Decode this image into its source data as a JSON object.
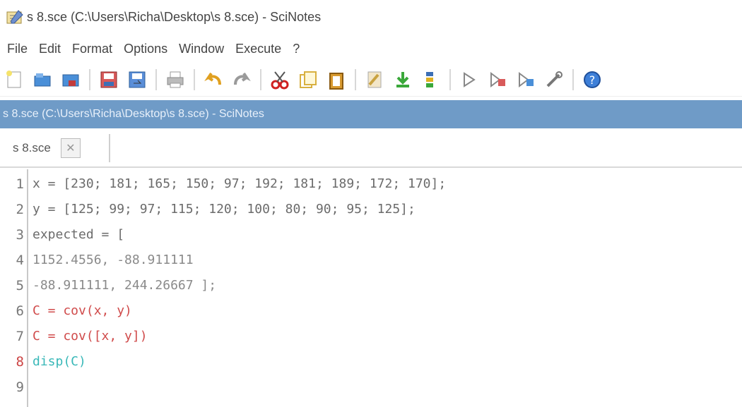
{
  "window": {
    "title": "s 8.sce (C:\\Users\\Richa\\Desktop\\s 8.sce) - SciNotes"
  },
  "menu": {
    "items": [
      "File",
      "Edit",
      "Format",
      "Options",
      "Window",
      "Execute",
      "?"
    ]
  },
  "toolbar": {
    "icons": [
      "new-file-icon",
      "open-file-icon",
      "open-folder-icon",
      "save-icon",
      "save-as-icon",
      "print-icon",
      "undo-icon",
      "redo-icon",
      "cut-icon",
      "copy-icon",
      "paste-icon",
      "find-icon",
      "load-into-scilab-icon",
      "execute-file-icon",
      "execute-icon",
      "execute-selection-icon",
      "debug-icon",
      "tools-icon",
      "help-icon"
    ]
  },
  "document_bar": {
    "title": "s 8.sce (C:\\Users\\Richa\\Desktop\\s 8.sce) - SciNotes"
  },
  "tabs": [
    {
      "label": "s 8.sce",
      "close_icon": "close-icon"
    }
  ],
  "editor": {
    "current_line": 8,
    "lines": [
      {
        "number": "1",
        "text": "x = [230; 181; 165; 150; 97; 192; 181; 189; 172; 170];"
      },
      {
        "number": "2",
        "text": "y = [125; 99; 97; 115; 120; 100; 80; 90; 95; 125];"
      },
      {
        "number": "3",
        "text": "expected = ["
      },
      {
        "number": "4",
        "text": "1152.4556, -88.911111"
      },
      {
        "number": "5",
        "text": "-88.911111, 244.26667 ];"
      },
      {
        "number": "6",
        "text": "C = cov(x, y)"
      },
      {
        "number": "7",
        "text": "C = cov([x, y])"
      },
      {
        "number": "8",
        "text": "disp(C)"
      },
      {
        "number": "9",
        "text": ""
      }
    ]
  },
  "colors": {
    "docbar_bg": "#6f9bc7",
    "function_color": "#8a48b8",
    "variable_color": "#d04b4b",
    "disp_color": "#39b8b8"
  }
}
